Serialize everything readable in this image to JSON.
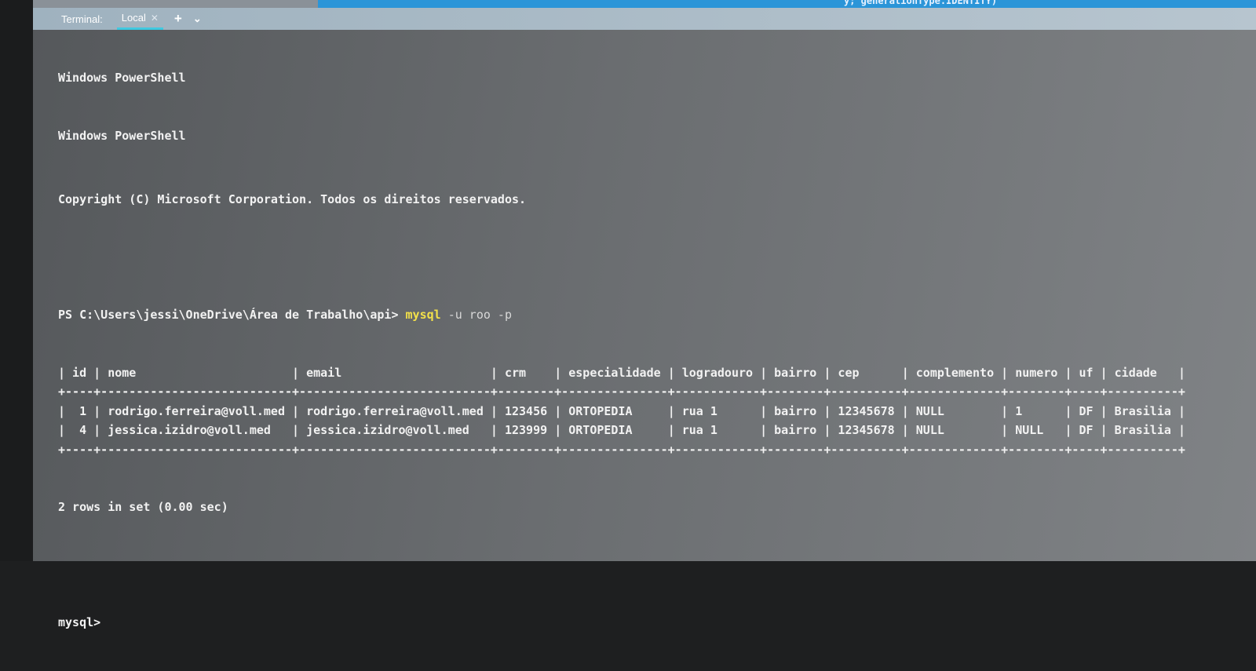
{
  "editor": {
    "code_fragment": "y; generationType.IDENTITY)"
  },
  "terminal_bar": {
    "label": "Terminal:",
    "tab": "Local",
    "close_icon": "close-icon",
    "add_icon": "plus-icon",
    "menu_icon": "chevron-down-icon"
  },
  "output": {
    "header1": "Windows PowerShell",
    "header2": "Windows PowerShell",
    "copyright": "Copyright (C) Microsoft Corporation. Todos os direitos reservados.",
    "prompt": "PS C:\\Users\\jessi\\OneDrive\\Área de Trabalho\\api> ",
    "command": "mysql",
    "args": " -u roo -p",
    "result_summary": "2 rows in set (0.00 sec)",
    "mysql_prompt": "mysql>"
  },
  "table": {
    "columns": [
      "id",
      "nome",
      "email",
      "crm",
      "especialidade",
      "logradouro",
      "bairro",
      "cep",
      "complemento",
      "numero",
      "uf",
      "cidade"
    ],
    "rows": [
      [
        "1",
        "rodrigo.ferreira@voll.med",
        "rodrigo.ferreira@voll.med",
        "123456",
        "ORTOPEDIA",
        "rua 1",
        "bairro",
        "12345678",
        "NULL",
        "1",
        "DF",
        "Brasilia"
      ],
      [
        "4",
        "jessica.izidro@voll.med",
        "jessica.izidro@voll.med",
        "123999",
        "ORTOPEDIA",
        "rua 1",
        "bairro",
        "12345678",
        "NULL",
        "NULL",
        "DF",
        "Brasilia"
      ]
    ]
  },
  "colors": {
    "command": "#f2e04a",
    "tab_underline": "#3fc9e0",
    "editor_accent": "#2b95d8"
  }
}
